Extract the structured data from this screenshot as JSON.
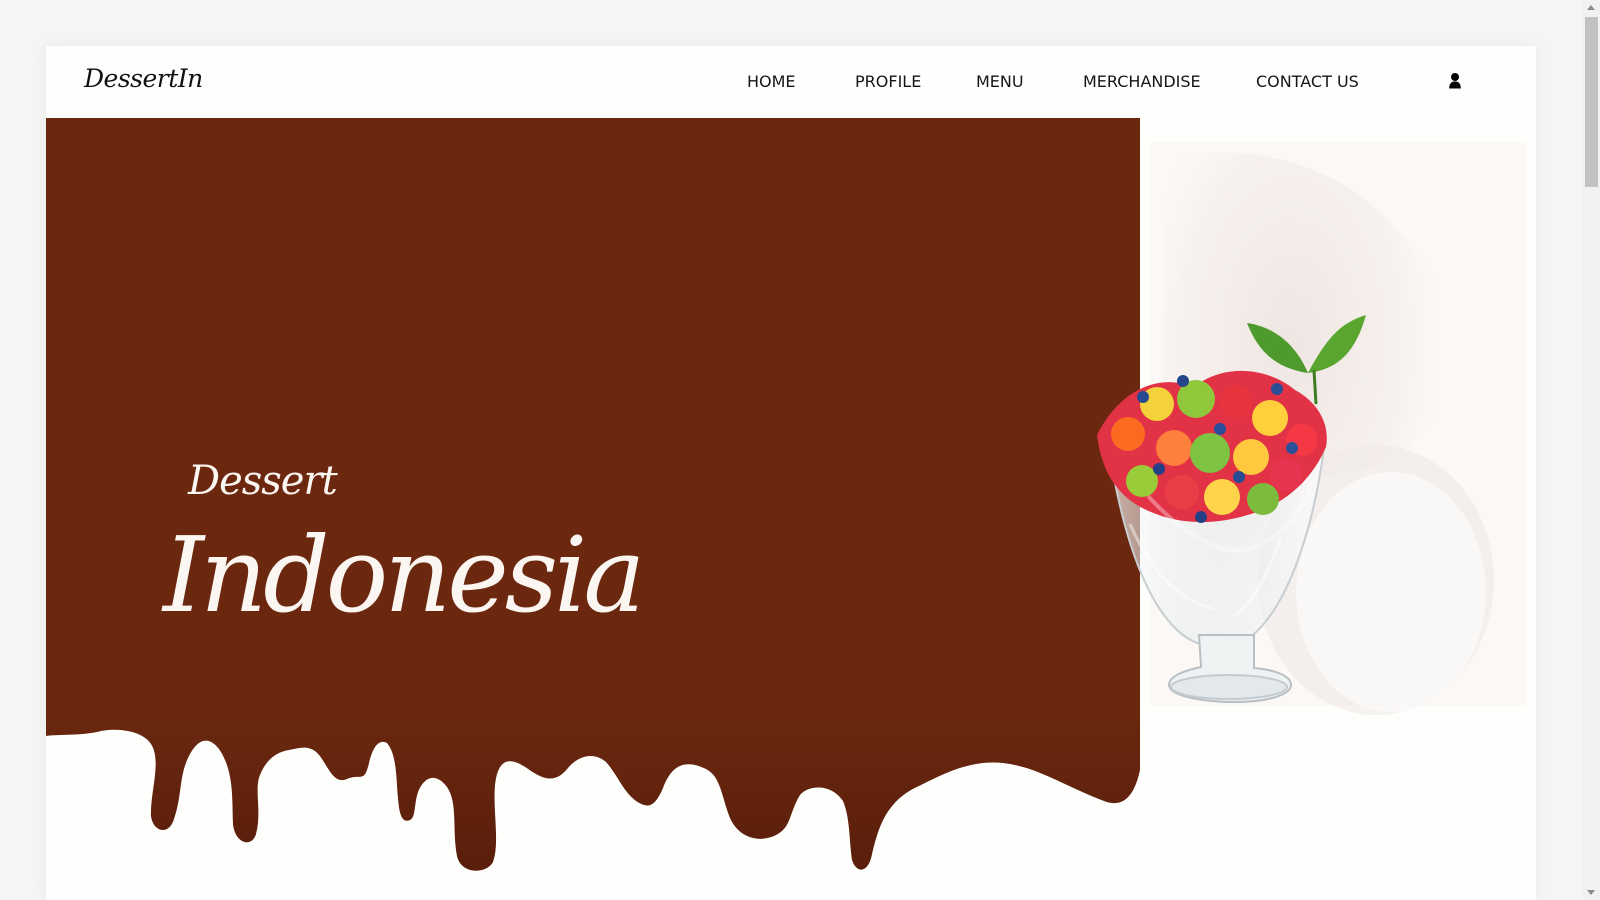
{
  "header": {
    "logo": "DessertIn",
    "nav": [
      "HOME",
      "PROFILE",
      "MENU",
      "MERCHANDISE",
      "CONTACT US"
    ],
    "user_icon": "user-icon"
  },
  "hero": {
    "subtitle": "Dessert",
    "title": "Indonesia",
    "image_subject": "fruit-salad-in-glass-bowl"
  },
  "colors": {
    "brown": "#6d2810",
    "cream": "#fefefc",
    "text": "#151515"
  }
}
